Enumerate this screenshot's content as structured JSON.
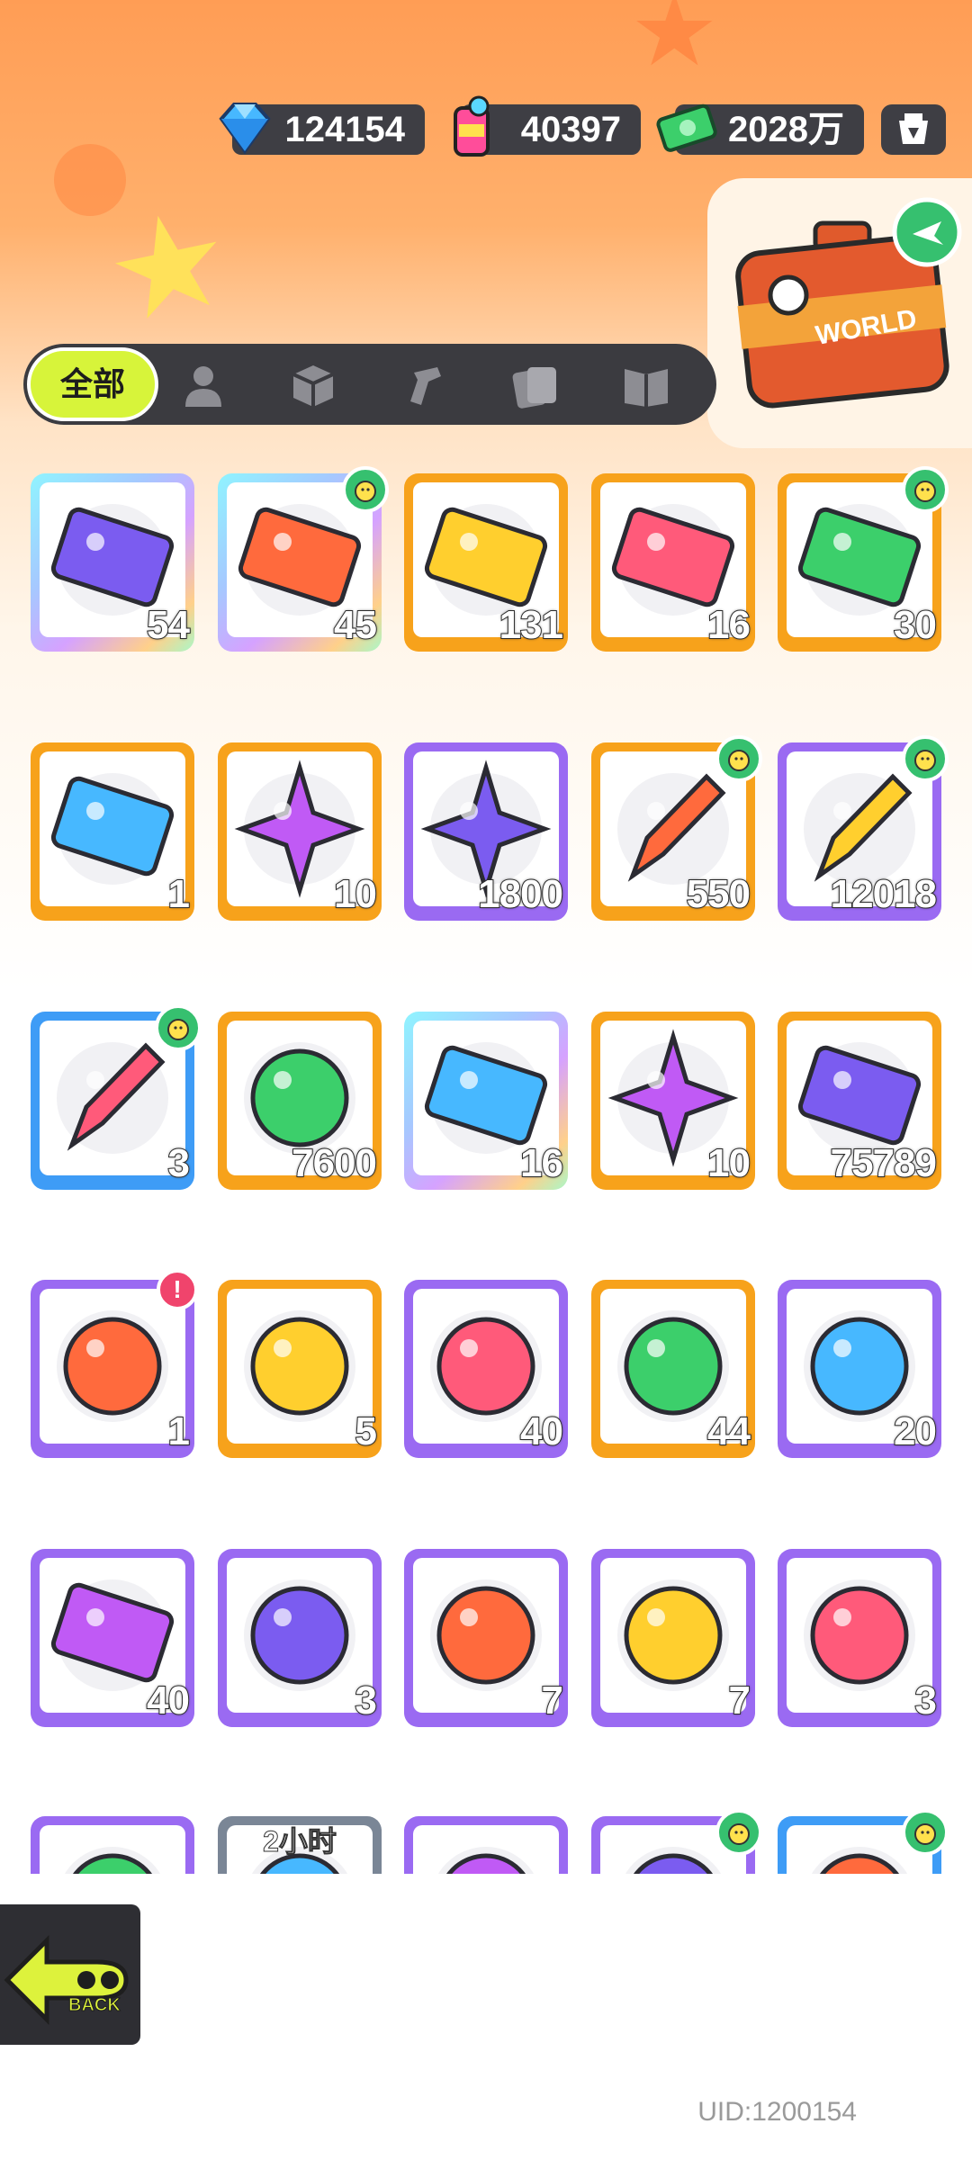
{
  "currencies": {
    "diamond": {
      "icon": "diamond-icon",
      "value": "124154"
    },
    "paint": {
      "icon": "paint-can-icon",
      "value": "40397"
    },
    "cash": {
      "icon": "cash-icon",
      "value": "2028万"
    }
  },
  "settings_icon": "lantern-icon",
  "travel_case": {
    "icon": "travel-case-icon",
    "label": "WORLD"
  },
  "tabs": [
    {
      "label": "全部",
      "active": true
    },
    {
      "icon": "person-icon"
    },
    {
      "icon": "box-icon"
    },
    {
      "icon": "spray-icon"
    },
    {
      "icon": "cards-icon"
    },
    {
      "icon": "book-icon"
    }
  ],
  "items": [
    {
      "name": "purple-ticket",
      "qty": "54",
      "frame": "rainbow"
    },
    {
      "name": "lion-dance-ticket",
      "qty": "45",
      "frame": "rainbow",
      "new": true
    },
    {
      "name": "yellow-ticket",
      "qty": "131",
      "frame": "orange"
    },
    {
      "name": "character-ticket",
      "qty": "16",
      "frame": "orange"
    },
    {
      "name": "food-ticket",
      "qty": "30",
      "frame": "orange",
      "new": true
    },
    {
      "name": "violet-ticket",
      "qty": "1",
      "frame": "orange"
    },
    {
      "name": "rainbow-leaf-star",
      "qty": "10",
      "frame": "orange"
    },
    {
      "name": "blue-crystal-star",
      "qty": "1800",
      "frame": "purple"
    },
    {
      "name": "yellow-crayon",
      "qty": "550",
      "frame": "orange",
      "new": true
    },
    {
      "name": "purple-crayon",
      "qty": "12018",
      "frame": "purple",
      "new": true
    },
    {
      "name": "blue-crayon",
      "qty": "3",
      "frame": "blue",
      "new": true
    },
    {
      "name": "cool-coin",
      "qty": "7600",
      "frame": "orange"
    },
    {
      "name": "lottery-ticket",
      "qty": "16",
      "frame": "rainbow"
    },
    {
      "name": "star-badge",
      "qty": "10",
      "frame": "orange"
    },
    {
      "name": "season-ticket",
      "qty": "75789",
      "frame": "orange"
    },
    {
      "name": "cool-box",
      "qty": "1",
      "frame": "purple",
      "alert": "!"
    },
    {
      "name": "gold-mystery-egg",
      "qty": "5",
      "frame": "orange"
    },
    {
      "name": "purple-mystery-egg",
      "qty": "40",
      "frame": "purple"
    },
    {
      "name": "gold-deity-coin",
      "qty": "44",
      "frame": "orange"
    },
    {
      "name": "purple-deity-coin",
      "qty": "20",
      "frame": "purple"
    },
    {
      "name": "travel-mystery-card",
      "qty": "40",
      "frame": "purple"
    },
    {
      "name": "monster-orb",
      "qty": "3",
      "frame": "purple"
    },
    {
      "name": "fish-orb",
      "qty": "7",
      "frame": "purple"
    },
    {
      "name": "piranha-orb",
      "qty": "7",
      "frame": "purple"
    },
    {
      "name": "jelly-orb",
      "qty": "3",
      "frame": "purple"
    },
    {
      "name": "partial-orb",
      "qty": "",
      "frame": "purple"
    },
    {
      "name": "timed-item",
      "qty": "",
      "frame": "gray",
      "timer": "2小时"
    },
    {
      "name": "partial-orb-2",
      "qty": "",
      "frame": "purple"
    },
    {
      "name": "partial-item",
      "qty": "",
      "frame": "purple",
      "new": true
    },
    {
      "name": "partial-item-2",
      "qty": "",
      "frame": "blue",
      "new": true
    }
  ],
  "back_label": "BACK",
  "uid": "UID:1200154"
}
